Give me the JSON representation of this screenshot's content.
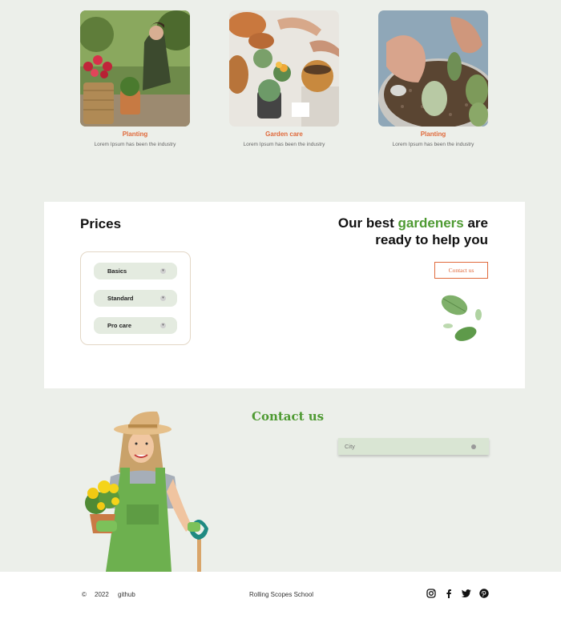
{
  "services": [
    {
      "title": "Planting",
      "text": "Lorem Ipsum has been the industry"
    },
    {
      "title": "Garden care",
      "text": "Lorem Ipsum has been the industry"
    },
    {
      "title": "Planting",
      "text": "Lorem Ipsum has been the industry"
    }
  ],
  "prices": {
    "title": "Prices",
    "items": [
      "Basics",
      "Standard",
      "Pro care"
    ]
  },
  "promo": {
    "line1_before": "Our best ",
    "line1_accent": "gardeners",
    "line1_after": " are",
    "line2": "ready to help you",
    "button_label": "Contact us"
  },
  "contact": {
    "title": "Contact us",
    "city_placeholder": "City"
  },
  "footer": {
    "copyright": "©",
    "year": "2022",
    "github": "github",
    "school": "Rolling Scopes School",
    "socials": [
      "instagram-icon",
      "facebook-icon",
      "twitter-icon",
      "pinterest-icon"
    ]
  },
  "colors": {
    "background": "#ecefea",
    "accent_green": "#4e9a32",
    "accent_orange": "#e06a3c",
    "price_item_bg": "#e4ebe0"
  }
}
